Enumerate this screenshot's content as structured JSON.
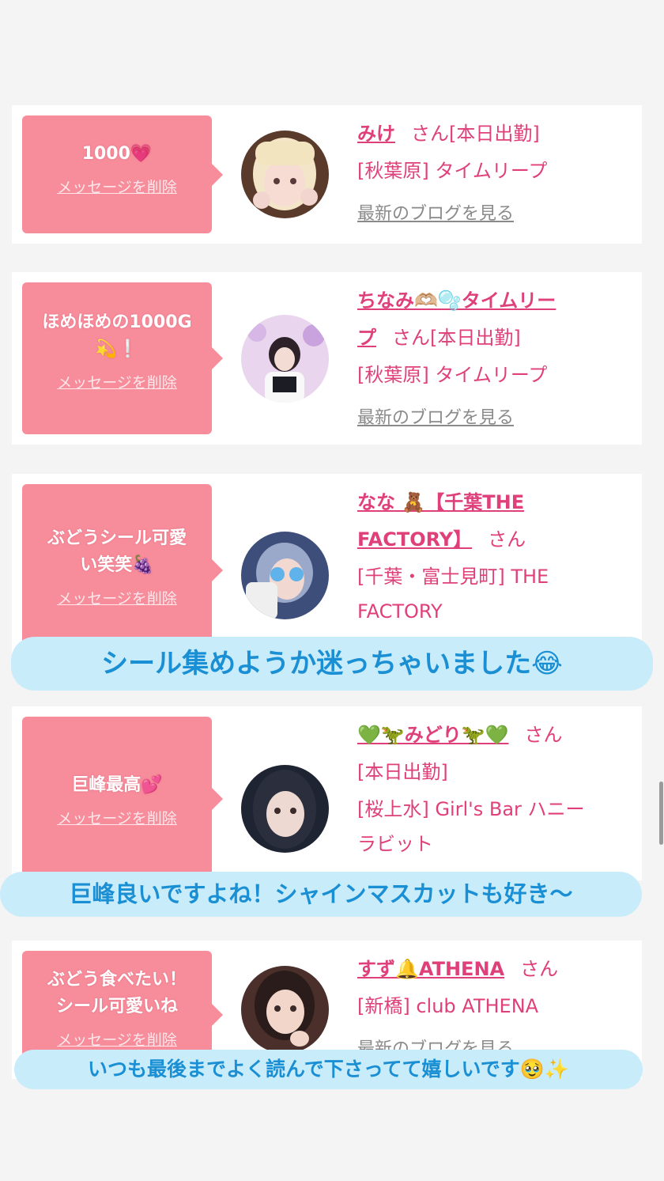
{
  "items": [
    {
      "message": "1000💗",
      "delete_label": "メッセージを削除",
      "name": "みけ",
      "san": "さん",
      "status": "[本日出勤]",
      "shop": "[秋葉原] タイムリープ",
      "blog_label": "最新のブログを見る"
    },
    {
      "message_line1": "ほめほめの1000G",
      "message_line2": "💫❕",
      "delete_label": "メッセージを削除",
      "name_line1": "ちなみ🫶🏼🫧タイムリー",
      "name_line2": "プ",
      "san": "さん",
      "status": "[本日出勤]",
      "shop": "[秋葉原] タイムリープ",
      "blog_label": "最新のブログを見る"
    },
    {
      "message_line1": "ぶどうシール可愛",
      "message_line2": "い笑笑🍇",
      "delete_label": "メッセージを削除",
      "name_line1": "なな 🧸【千葉THE",
      "name_line2": "FACTORY】",
      "san": "さん",
      "shop_line1": "[千葉・富士見町] THE",
      "shop_line2": "FACTORY"
    },
    {
      "message": "巨峰最高💕",
      "delete_label": "メッセージを削除",
      "name": "💚🦖みどり🦖💚",
      "san": "さん",
      "status": "[本日出勤]",
      "shop_line1": "[桜上水] Girl's Bar ハニー",
      "shop_line2": "ラビット"
    },
    {
      "message_line1": "ぶどう食べたい！",
      "message_line2": "シール可愛いね",
      "delete_label": "メッセージを削除",
      "name": "すず🔔ATHENA",
      "san": "さん",
      "shop": "[新橋] club ATHENA",
      "blog_label": "最新のブログを見る"
    }
  ],
  "captions": [
    "シール集めようか迷っちゃいました😂",
    "巨峰良いですよね！シャインマスカットも好き〜",
    "いつも最後までよく読んで下さってて嬉しいです🥹✨"
  ],
  "colors": {
    "bubble": "#f78c9b",
    "name": "#e0407a",
    "caption_bg": "#c9ecfb",
    "caption_text": "#1a8fd3",
    "page_bg": "#f4f4f4"
  }
}
